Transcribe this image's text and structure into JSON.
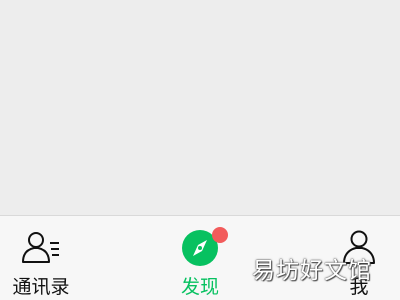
{
  "tabbar": {
    "tabs": [
      {
        "label": "通讯录",
        "icon": "contacts-icon",
        "active": false
      },
      {
        "label": "发现",
        "icon": "compass-icon",
        "active": true,
        "badge": true
      },
      {
        "label": "我",
        "icon": "person-icon",
        "active": false
      }
    ]
  },
  "watermark": "易坊好文馆",
  "colors": {
    "accent": "#07c160",
    "badge": "#f25b5b",
    "background": "#ededed",
    "tabbar": "#f7f7f7"
  }
}
